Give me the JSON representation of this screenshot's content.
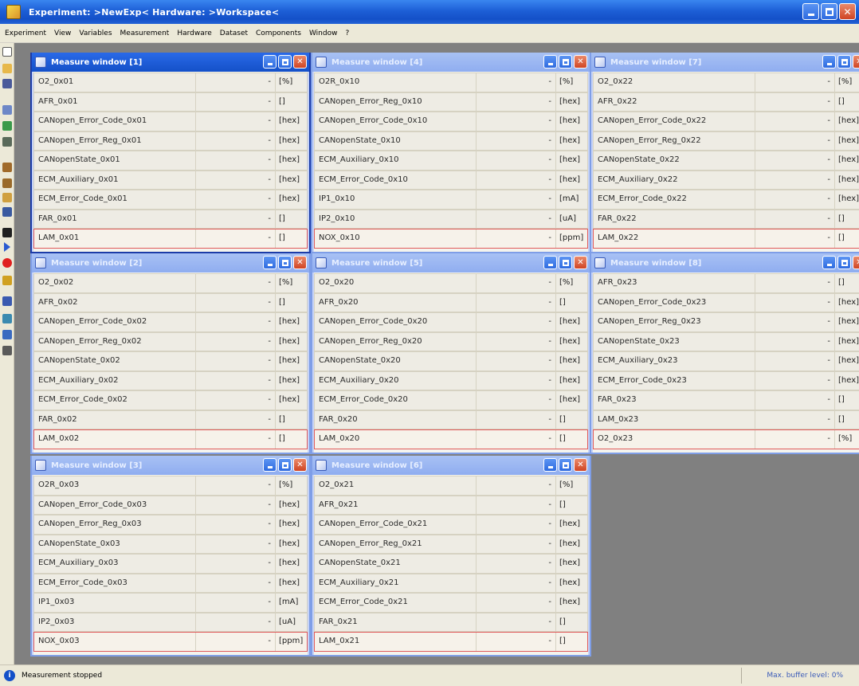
{
  "app": {
    "title": "Experiment: >NewExp< Hardware: >Workspace<"
  },
  "menu": [
    "Experiment",
    "View",
    "Variables",
    "Measurement",
    "Hardware",
    "Dataset",
    "Components",
    "Window",
    "?"
  ],
  "toolbar_icons": [
    {
      "name": "new-icon",
      "color": "#ffffff"
    },
    {
      "name": "open-icon",
      "color": "#e7b84a"
    },
    {
      "name": "save-icon",
      "color": "#4a5a9a"
    },
    {
      "name": "window-icon",
      "color": "#6d87c7"
    },
    {
      "name": "hardware-icon",
      "color": "#3a9a4a"
    },
    {
      "name": "dataset-icon",
      "color": "#5a6a5a"
    },
    {
      "name": "config-icon",
      "color": "#a06a2a"
    },
    {
      "name": "variables-icon",
      "color": "#9a6a2a"
    },
    {
      "name": "calibrate-icon",
      "color": "#d0a040"
    },
    {
      "name": "monitor-icon",
      "color": "#3a5aa0"
    },
    {
      "name": "stop-icon",
      "color": "#202020"
    },
    {
      "name": "start-icon",
      "color": "#2a5ad0"
    },
    {
      "name": "record-icon",
      "color": "#e02020"
    },
    {
      "name": "pause-icon",
      "color": "#d0a020"
    },
    {
      "name": "display-icon",
      "color": "#3a5ab0"
    },
    {
      "name": "graph-icon",
      "color": "#3a8ab0"
    },
    {
      "name": "table-icon",
      "color": "#3a6ac0"
    },
    {
      "name": "report-icon",
      "color": "#5a5a5a"
    }
  ],
  "windows": [
    {
      "title": "Measure window [1]",
      "active": true,
      "rows": [
        {
          "name": "O2_0x01",
          "value": "-",
          "unit": "[%]"
        },
        {
          "name": "AFR_0x01",
          "value": "-",
          "unit": "[]"
        },
        {
          "name": "CANopen_Error_Code_0x01",
          "value": "-",
          "unit": "[hex]"
        },
        {
          "name": "CANopen_Error_Reg_0x01",
          "value": "-",
          "unit": "[hex]"
        },
        {
          "name": "CANopenState_0x01",
          "value": "-",
          "unit": "[hex]"
        },
        {
          "name": "ECM_Auxiliary_0x01",
          "value": "-",
          "unit": "[hex]"
        },
        {
          "name": "ECM_Error_Code_0x01",
          "value": "-",
          "unit": "[hex]"
        },
        {
          "name": "FAR_0x01",
          "value": "-",
          "unit": "[]"
        },
        {
          "name": "LAM_0x01",
          "value": "-",
          "unit": "[]"
        }
      ]
    },
    {
      "title": "Measure window [4]",
      "active": false,
      "rows": [
        {
          "name": "O2R_0x10",
          "value": "-",
          "unit": "[%]"
        },
        {
          "name": "CANopen_Error_Reg_0x10",
          "value": "-",
          "unit": "[hex]"
        },
        {
          "name": "CANopen_Error_Code_0x10",
          "value": "-",
          "unit": "[hex]"
        },
        {
          "name": "CANopenState_0x10",
          "value": "-",
          "unit": "[hex]"
        },
        {
          "name": "ECM_Auxiliary_0x10",
          "value": "-",
          "unit": "[hex]"
        },
        {
          "name": "ECM_Error_Code_0x10",
          "value": "-",
          "unit": "[hex]"
        },
        {
          "name": "IP1_0x10",
          "value": "-",
          "unit": "[mA]"
        },
        {
          "name": "IP2_0x10",
          "value": "-",
          "unit": "[uA]"
        },
        {
          "name": "NOX_0x10",
          "value": "-",
          "unit": "[ppm]"
        }
      ]
    },
    {
      "title": "Measure window [7]",
      "active": false,
      "rows": [
        {
          "name": "O2_0x22",
          "value": "-",
          "unit": "[%]"
        },
        {
          "name": "AFR_0x22",
          "value": "-",
          "unit": "[]"
        },
        {
          "name": "CANopen_Error_Code_0x22",
          "value": "-",
          "unit": "[hex]"
        },
        {
          "name": "CANopen_Error_Reg_0x22",
          "value": "-",
          "unit": "[hex]"
        },
        {
          "name": "CANopenState_0x22",
          "value": "-",
          "unit": "[hex]"
        },
        {
          "name": "ECM_Auxiliary_0x22",
          "value": "-",
          "unit": "[hex]"
        },
        {
          "name": "ECM_Error_Code_0x22",
          "value": "-",
          "unit": "[hex]"
        },
        {
          "name": "FAR_0x22",
          "value": "-",
          "unit": "[]"
        },
        {
          "name": "LAM_0x22",
          "value": "-",
          "unit": "[]"
        }
      ]
    },
    {
      "title": "Measure window [2]",
      "active": false,
      "rows": [
        {
          "name": "O2_0x02",
          "value": "-",
          "unit": "[%]"
        },
        {
          "name": "AFR_0x02",
          "value": "-",
          "unit": "[]"
        },
        {
          "name": "CANopen_Error_Code_0x02",
          "value": "-",
          "unit": "[hex]"
        },
        {
          "name": "CANopen_Error_Reg_0x02",
          "value": "-",
          "unit": "[hex]"
        },
        {
          "name": "CANopenState_0x02",
          "value": "-",
          "unit": "[hex]"
        },
        {
          "name": "ECM_Auxiliary_0x02",
          "value": "-",
          "unit": "[hex]"
        },
        {
          "name": "ECM_Error_Code_0x02",
          "value": "-",
          "unit": "[hex]"
        },
        {
          "name": "FAR_0x02",
          "value": "-",
          "unit": "[]"
        },
        {
          "name": "LAM_0x02",
          "value": "-",
          "unit": "[]"
        }
      ]
    },
    {
      "title": "Measure window [5]",
      "active": false,
      "rows": [
        {
          "name": "O2_0x20",
          "value": "-",
          "unit": "[%]"
        },
        {
          "name": "AFR_0x20",
          "value": "-",
          "unit": "[]"
        },
        {
          "name": "CANopen_Error_Code_0x20",
          "value": "-",
          "unit": "[hex]"
        },
        {
          "name": "CANopen_Error_Reg_0x20",
          "value": "-",
          "unit": "[hex]"
        },
        {
          "name": "CANopenState_0x20",
          "value": "-",
          "unit": "[hex]"
        },
        {
          "name": "ECM_Auxiliary_0x20",
          "value": "-",
          "unit": "[hex]"
        },
        {
          "name": "ECM_Error_Code_0x20",
          "value": "-",
          "unit": "[hex]"
        },
        {
          "name": "FAR_0x20",
          "value": "-",
          "unit": "[]"
        },
        {
          "name": "LAM_0x20",
          "value": "-",
          "unit": "[]"
        }
      ]
    },
    {
      "title": "Measure window [8]",
      "active": false,
      "rows": [
        {
          "name": "AFR_0x23",
          "value": "-",
          "unit": "[]"
        },
        {
          "name": "CANopen_Error_Code_0x23",
          "value": "-",
          "unit": "[hex]"
        },
        {
          "name": "CANopen_Error_Reg_0x23",
          "value": "-",
          "unit": "[hex]"
        },
        {
          "name": "CANopenState_0x23",
          "value": "-",
          "unit": "[hex]"
        },
        {
          "name": "ECM_Auxiliary_0x23",
          "value": "-",
          "unit": "[hex]"
        },
        {
          "name": "ECM_Error_Code_0x23",
          "value": "-",
          "unit": "[hex]"
        },
        {
          "name": "FAR_0x23",
          "value": "-",
          "unit": "[]"
        },
        {
          "name": "LAM_0x23",
          "value": "-",
          "unit": "[]"
        },
        {
          "name": "O2_0x23",
          "value": "-",
          "unit": "[%]"
        }
      ]
    },
    {
      "title": "Measure window [3]",
      "active": false,
      "rows": [
        {
          "name": "O2R_0x03",
          "value": "-",
          "unit": "[%]"
        },
        {
          "name": "CANopen_Error_Code_0x03",
          "value": "-",
          "unit": "[hex]"
        },
        {
          "name": "CANopen_Error_Reg_0x03",
          "value": "-",
          "unit": "[hex]"
        },
        {
          "name": "CANopenState_0x03",
          "value": "-",
          "unit": "[hex]"
        },
        {
          "name": "ECM_Auxiliary_0x03",
          "value": "-",
          "unit": "[hex]"
        },
        {
          "name": "ECM_Error_Code_0x03",
          "value": "-",
          "unit": "[hex]"
        },
        {
          "name": "IP1_0x03",
          "value": "-",
          "unit": "[mA]"
        },
        {
          "name": "IP2_0x03",
          "value": "-",
          "unit": "[uA]"
        },
        {
          "name": "NOX_0x03",
          "value": "-",
          "unit": "[ppm]"
        }
      ]
    },
    {
      "title": "Measure window [6]",
      "active": false,
      "rows": [
        {
          "name": "O2_0x21",
          "value": "-",
          "unit": "[%]"
        },
        {
          "name": "AFR_0x21",
          "value": "-",
          "unit": "[]"
        },
        {
          "name": "CANopen_Error_Code_0x21",
          "value": "-",
          "unit": "[hex]"
        },
        {
          "name": "CANopen_Error_Reg_0x21",
          "value": "-",
          "unit": "[hex]"
        },
        {
          "name": "CANopenState_0x21",
          "value": "-",
          "unit": "[hex]"
        },
        {
          "name": "ECM_Auxiliary_0x21",
          "value": "-",
          "unit": "[hex]"
        },
        {
          "name": "ECM_Error_Code_0x21",
          "value": "-",
          "unit": "[hex]"
        },
        {
          "name": "FAR_0x21",
          "value": "-",
          "unit": "[]"
        },
        {
          "name": "LAM_0x21",
          "value": "-",
          "unit": "[]"
        }
      ]
    }
  ],
  "status": {
    "text": "Measurement stopped",
    "buffer": "Max. buffer level: 0%"
  }
}
